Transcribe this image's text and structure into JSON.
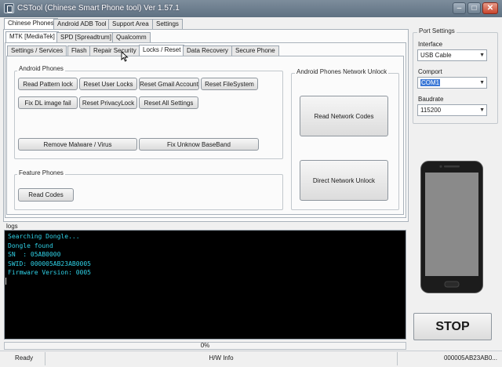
{
  "window": {
    "title": "CSTool (Chinese Smart Phone tool)  Ver 1.57.1",
    "minimize": "–",
    "maximize": "□",
    "close": "✕"
  },
  "main_tabs": [
    "Chinese Phones",
    "Android ADB Tool",
    "Support Area",
    "Settings"
  ],
  "chip_tabs": [
    "MTK [MediaTek]",
    "SPD [Spreadtrum]",
    "Qualcomm"
  ],
  "func_tabs": [
    "Settings / Services",
    "Flash",
    "Repair Security",
    "Locks / Reset",
    "Data Recovery",
    "Secure Phone"
  ],
  "android_phones": {
    "label": "Android Phones",
    "buttons": {
      "read_pattern_lock": "Read Pattern lock",
      "reset_user_locks": "Reset User Locks",
      "reset_gmail_account": "Reset Gmail Account",
      "reset_filesystem": "Reset FileSystem",
      "fix_dl_image_fail": "Fix DL image fail",
      "reset_privacylock": "Reset PrivacyLock",
      "reset_all_settings": "Reset All Settings",
      "remove_malware": "Remove Malware / Virus",
      "fix_unknown_baseband": "Fix Unknow BaseBand"
    }
  },
  "feature_phones": {
    "label": "Feature Phones",
    "read_codes": "Read Codes"
  },
  "network_unlock": {
    "label": "Android Phones Network Unlock",
    "read_network_codes": "Read Network Codes",
    "direct_network_unlock": "Direct Network Unlock"
  },
  "port_settings": {
    "label": "Port Settings",
    "interface_label": "Interface",
    "interface_value": "USB Cable",
    "comport_label": "Comport",
    "comport_value": "COM1",
    "baudrate_label": "Baudrate",
    "baudrate_value": "115200"
  },
  "logs": {
    "label": "logs",
    "lines": [
      "Searching Dongle...",
      "Dongle found",
      "SN  : 05AB0000",
      "SWID: 000005AB23AB0005",
      "Firmware Version: 0005"
    ]
  },
  "stop_button": "STOP",
  "progress": {
    "text": "0%",
    "value": 0
  },
  "statusbar": {
    "status": "Ready",
    "center": "H/W Info",
    "right": "000005AB23AB0..."
  },
  "colors": {
    "accent": "#3b78d6",
    "log_text": "#2fd1e6",
    "log_bg": "#000000"
  }
}
